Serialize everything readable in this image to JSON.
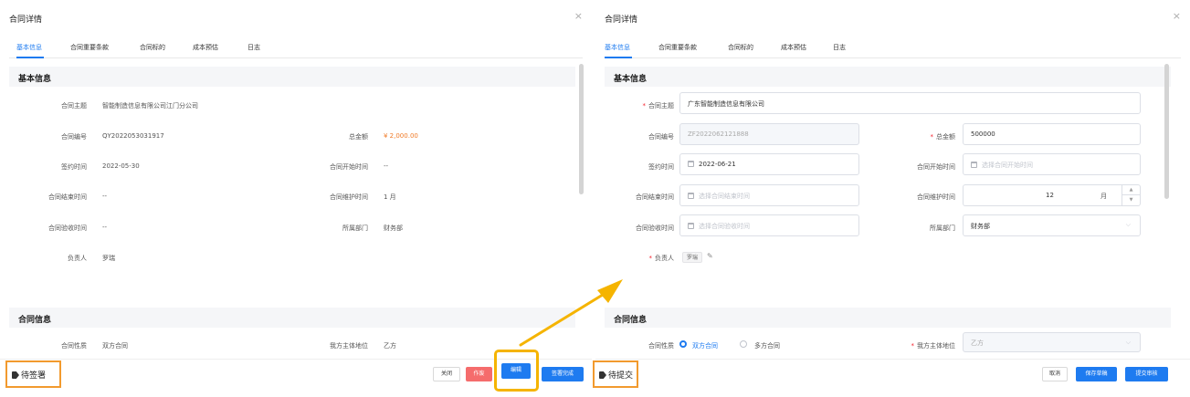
{
  "left": {
    "title": "合同详情",
    "close": "×",
    "tabs": [
      "基本信息",
      "合同重要条款",
      "合同标的",
      "成本预估",
      "日志"
    ],
    "section_basic": "基本信息",
    "fields": {
      "subject_label": "合同主题",
      "subject_value": "智能制造信息有限公司江门分公司",
      "number_label": "合同编号",
      "number_value": "QY2022053031917",
      "total_label": "总金额",
      "total_value": "¥ 2,000.00",
      "sign_label": "签约时间",
      "sign_value": "2022-05-30",
      "start_label": "合同开始时间",
      "start_value": "--",
      "end_label": "合同结束时间",
      "end_value": "--",
      "maint_label": "合同维护时间",
      "maint_value": "1 月",
      "accept_label": "合同验收时间",
      "accept_value": "--",
      "dept_label": "所属部门",
      "dept_value": "财务部",
      "owner_label": "负责人",
      "owner_value": "罗瑞"
    },
    "section_contract": "合同信息",
    "nature_label": "合同性质",
    "nature_value": "双方合同",
    "party_label": "我方主体地位",
    "party_value": "乙方",
    "status": "待签署",
    "buttons": {
      "close": "关闭",
      "void": "作废",
      "edit": "编辑",
      "signed": "签署完成"
    }
  },
  "right": {
    "title": "合同详情",
    "close": "×",
    "tabs": [
      "基本信息",
      "合同重要条款",
      "合同标的",
      "成本预估",
      "日志"
    ],
    "section_basic": "基本信息",
    "required_mark": "*",
    "fields": {
      "subject_label": "合同主题",
      "subject_value": "广东智能制造信息有限公司",
      "number_label": "合同编号",
      "number_value": "ZF2022062121888",
      "total_label": "总金额",
      "total_value": "500000",
      "sign_label": "签约时间",
      "sign_value": "2022-06-21",
      "start_label": "合同开始时间",
      "start_placeholder": "选择合同开始时间",
      "end_label": "合同结束时间",
      "end_placeholder": "选择合同结束时间",
      "maint_label": "合同维护时间",
      "maint_value": "12",
      "maint_unit": "月",
      "accept_label": "合同验收时间",
      "accept_placeholder": "选择合同验收时间",
      "dept_label": "所属部门",
      "dept_value": "财务部",
      "owner_label": "负责人",
      "owner_value": "罗瑞"
    },
    "section_contract": "合同信息",
    "nature_label": "合同性质",
    "nature_options": [
      "双方合同",
      "多方合同"
    ],
    "party_label": "我方主体地位",
    "party_value": "乙方",
    "status": "待提交",
    "buttons": {
      "cancel": "取消",
      "save_draft": "保存草稿",
      "submit": "提交审核"
    }
  },
  "colors": {
    "primary": "#1e7bf0",
    "danger": "#f56c6c",
    "amount": "#f07b28",
    "highlight": "#f5b400",
    "status_border": "#f29a2e"
  },
  "icons": [
    "close-icon",
    "tag-icon",
    "calendar-icon",
    "chevron-down-icon",
    "edit-icon",
    "arrow-icon"
  ]
}
